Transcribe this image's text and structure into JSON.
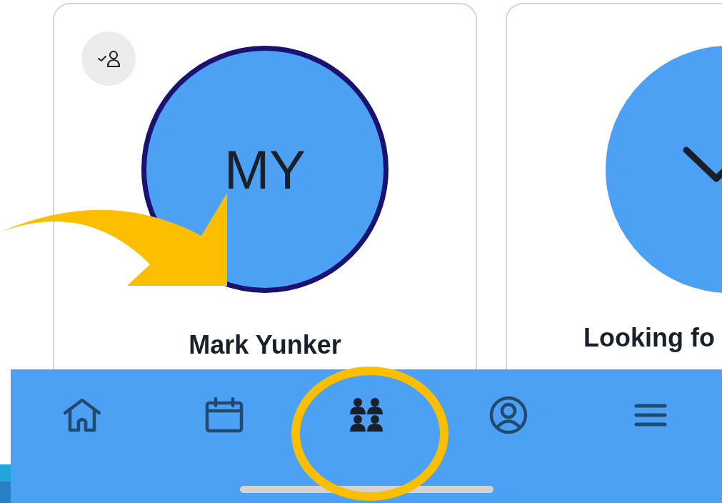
{
  "cards": [
    {
      "badge": true,
      "avatar": {
        "kind": "initials",
        "initials": "MY",
        "outlined": true
      },
      "title": "Mark Yunker"
    },
    {
      "badge": false,
      "avatar": {
        "kind": "check",
        "outlined": false
      },
      "title": "Looking fo"
    }
  ],
  "tab_bar": [
    {
      "kind": "home",
      "selected": false
    },
    {
      "kind": "calendar",
      "selected": false
    },
    {
      "kind": "groups",
      "selected": true
    },
    {
      "kind": "profile",
      "selected": false
    },
    {
      "kind": "menu",
      "selected": false
    }
  ]
}
